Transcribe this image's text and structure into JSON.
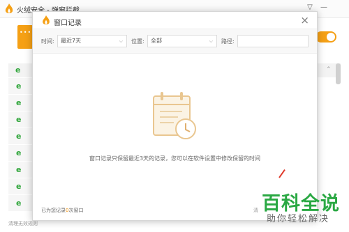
{
  "app": {
    "title": "火绒安全 - 弹窗拦截",
    "brand_color": "#f5a015",
    "controls": {
      "menu_icon": "dropdown-menu-icon",
      "minimize_icon": "minimize-icon"
    }
  },
  "background": {
    "footer_text": "清理无效规则",
    "row_icon": "ie-browser-icon"
  },
  "modal": {
    "title": "窗口记录",
    "close_icon": "close-icon",
    "filters": {
      "time_label": "时间:",
      "time_value": "最近7天",
      "location_label": "位置:",
      "location_value": "全部",
      "path_label": "路径:",
      "path_value": ""
    },
    "empty_message": "窗口记录只保留最近3天的记录，您可以在软件设置中修改保留的时间",
    "footer": {
      "prefix": "已为您记录",
      "count": "0",
      "suffix": "次窗口",
      "right_text": "清"
    }
  },
  "watermark": {
    "title": "百科全说",
    "subtitle": "助你轻松解决",
    "color": "#2aa843"
  }
}
